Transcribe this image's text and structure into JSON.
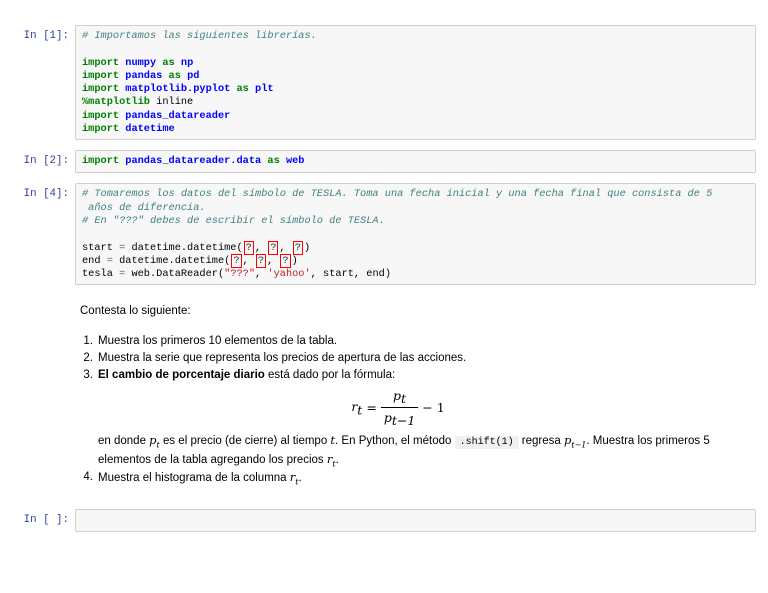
{
  "colors": {
    "prompt_text": "#303F9F",
    "comment": "#408080",
    "keyword": "#008000",
    "namespace": "#0000FF",
    "string": "#BA2121",
    "error_border": "#FF0000",
    "cell_bg": "#F7F7F7",
    "cell_border": "#CFCFCF"
  },
  "cells": {
    "c1": {
      "prompt": "In [1]:",
      "lines": [
        [
          [
            "c",
            "# Importamos las siguientes librerías."
          ]
        ],
        [],
        [
          [
            "k",
            "import"
          ],
          [
            "p",
            " "
          ],
          [
            "nn",
            "numpy"
          ],
          [
            "p",
            " "
          ],
          [
            "k",
            "as"
          ],
          [
            "p",
            " "
          ],
          [
            "nn",
            "np"
          ]
        ],
        [
          [
            "k",
            "import"
          ],
          [
            "p",
            " "
          ],
          [
            "nn",
            "pandas"
          ],
          [
            "p",
            " "
          ],
          [
            "k",
            "as"
          ],
          [
            "p",
            " "
          ],
          [
            "nn",
            "pd"
          ]
        ],
        [
          [
            "k",
            "import"
          ],
          [
            "p",
            " "
          ],
          [
            "nn",
            "matplotlib.pyplot"
          ],
          [
            "p",
            " "
          ],
          [
            "k",
            "as"
          ],
          [
            "p",
            " "
          ],
          [
            "nn",
            "plt"
          ]
        ],
        [
          [
            "k",
            "%matplotlib"
          ],
          [
            "p",
            " inline"
          ]
        ],
        [
          [
            "k",
            "import"
          ],
          [
            "p",
            " "
          ],
          [
            "nn",
            "pandas_datareader"
          ]
        ],
        [
          [
            "k",
            "import"
          ],
          [
            "p",
            " "
          ],
          [
            "nn",
            "datetime"
          ]
        ]
      ]
    },
    "c2": {
      "prompt": "In [2]:",
      "lines": [
        [
          [
            "k",
            "import"
          ],
          [
            "p",
            " "
          ],
          [
            "nn",
            "pandas_datareader.data"
          ],
          [
            "p",
            " "
          ],
          [
            "k",
            "as"
          ],
          [
            "p",
            " "
          ],
          [
            "nn",
            "web"
          ]
        ]
      ]
    },
    "c3": {
      "prompt": "In [4]:",
      "lines": [
        [
          [
            "c",
            "# Tomaremos los datos del símbolo de TESLA. Toma una fecha inicial y una fecha final que consista de 5"
          ]
        ],
        [
          [
            "c",
            " años de diferencia."
          ]
        ],
        [
          [
            "c",
            "# En \"???\" debes de escribir el símbolo de TESLA."
          ]
        ],
        [],
        [
          [
            "p",
            "start "
          ],
          [
            "o",
            "="
          ],
          [
            "p",
            " datetime.datetime("
          ],
          [
            "e",
            "?"
          ],
          [
            "p",
            ", "
          ],
          [
            "e",
            "?"
          ],
          [
            "p",
            ", "
          ],
          [
            "e",
            "?"
          ],
          [
            "p",
            ")"
          ]
        ],
        [
          [
            "p",
            "end "
          ],
          [
            "o",
            "="
          ],
          [
            "p",
            " datetime.datetime("
          ],
          [
            "e",
            "?"
          ],
          [
            "p",
            ", "
          ],
          [
            "e",
            "?"
          ],
          [
            "p",
            ", "
          ],
          [
            "e",
            "?"
          ],
          [
            "p",
            ")"
          ]
        ],
        [
          [
            "p",
            "tesla "
          ],
          [
            "o",
            "="
          ],
          [
            "p",
            " web.DataReader("
          ],
          [
            "s",
            "\"???\""
          ],
          [
            "p",
            ", "
          ],
          [
            "s",
            "'yahoo'"
          ],
          [
            "p",
            ", start, end)"
          ]
        ]
      ]
    },
    "md": {
      "intro": "Contesta lo siguiente:",
      "items": [
        {
          "num": "1.",
          "text": "Muestra los primeros 10 elementos de la tabla."
        },
        {
          "num": "2.",
          "text": "Muestra la serie que representa los precios de apertura de las acciones."
        },
        {
          "num": "3.",
          "bold": "El cambio de porcentaje diario",
          "text": " está dado por la fórmula:"
        }
      ],
      "formula": {
        "lhs_base": "r",
        "lhs_sub": "t",
        "equals": "=",
        "num_base": "p",
        "num_sub": "t",
        "den_base": "p",
        "den_sub": "t−1",
        "tail": "− 1"
      },
      "para": {
        "t1": "en donde ",
        "m1_base": "p",
        "m1_sub": "t",
        "t2": " es el precio (de cierre) al tiempo ",
        "m2": "t",
        "t3": ". En Python, el método ",
        "code": ".shift(1)",
        "t4": " regresa ",
        "m3_base": "p",
        "m3_sub": "t−1",
        "t5": ". Muestra los primeros 5 elementos de la tabla agregando los precios ",
        "m4_base": "r",
        "m4_sub": "t",
        "t6": "."
      },
      "item4": {
        "num": "4.",
        "t1": "Muestra el histograma de la columna ",
        "m_base": "r",
        "m_sub": "t",
        "t2": "."
      }
    },
    "empty": {
      "prompt": "In [ ]:"
    }
  }
}
